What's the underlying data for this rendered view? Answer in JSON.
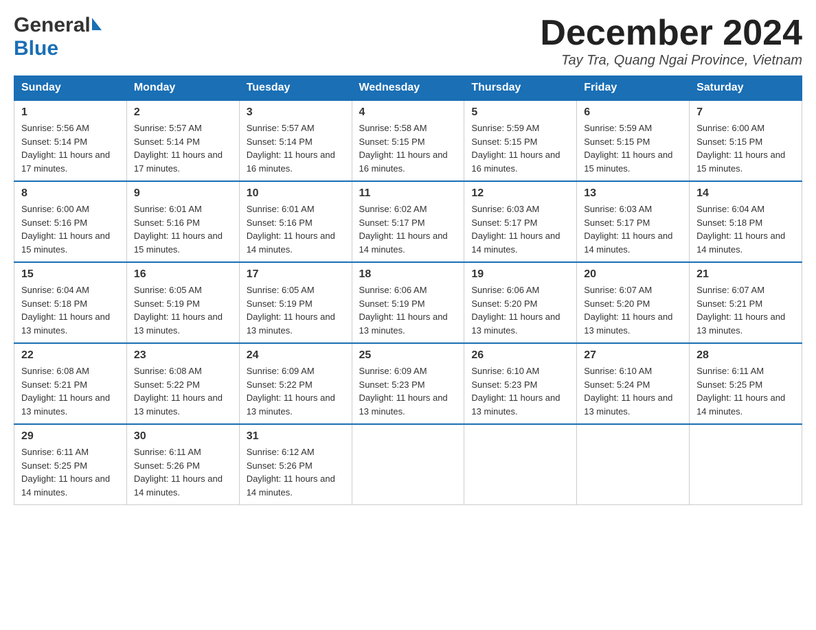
{
  "header": {
    "logo": {
      "general": "General",
      "blue": "Blue"
    },
    "title": "December 2024",
    "location": "Tay Tra, Quang Ngai Province, Vietnam"
  },
  "calendar": {
    "days": [
      "Sunday",
      "Monday",
      "Tuesday",
      "Wednesday",
      "Thursday",
      "Friday",
      "Saturday"
    ],
    "weeks": [
      [
        {
          "day": "1",
          "sunrise": "5:56 AM",
          "sunset": "5:14 PM",
          "daylight": "11 hours and 17 minutes."
        },
        {
          "day": "2",
          "sunrise": "5:57 AM",
          "sunset": "5:14 PM",
          "daylight": "11 hours and 17 minutes."
        },
        {
          "day": "3",
          "sunrise": "5:57 AM",
          "sunset": "5:14 PM",
          "daylight": "11 hours and 16 minutes."
        },
        {
          "day": "4",
          "sunrise": "5:58 AM",
          "sunset": "5:15 PM",
          "daylight": "11 hours and 16 minutes."
        },
        {
          "day": "5",
          "sunrise": "5:59 AM",
          "sunset": "5:15 PM",
          "daylight": "11 hours and 16 minutes."
        },
        {
          "day": "6",
          "sunrise": "5:59 AM",
          "sunset": "5:15 PM",
          "daylight": "11 hours and 15 minutes."
        },
        {
          "day": "7",
          "sunrise": "6:00 AM",
          "sunset": "5:15 PM",
          "daylight": "11 hours and 15 minutes."
        }
      ],
      [
        {
          "day": "8",
          "sunrise": "6:00 AM",
          "sunset": "5:16 PM",
          "daylight": "11 hours and 15 minutes."
        },
        {
          "day": "9",
          "sunrise": "6:01 AM",
          "sunset": "5:16 PM",
          "daylight": "11 hours and 15 minutes."
        },
        {
          "day": "10",
          "sunrise": "6:01 AM",
          "sunset": "5:16 PM",
          "daylight": "11 hours and 14 minutes."
        },
        {
          "day": "11",
          "sunrise": "6:02 AM",
          "sunset": "5:17 PM",
          "daylight": "11 hours and 14 minutes."
        },
        {
          "day": "12",
          "sunrise": "6:03 AM",
          "sunset": "5:17 PM",
          "daylight": "11 hours and 14 minutes."
        },
        {
          "day": "13",
          "sunrise": "6:03 AM",
          "sunset": "5:17 PM",
          "daylight": "11 hours and 14 minutes."
        },
        {
          "day": "14",
          "sunrise": "6:04 AM",
          "sunset": "5:18 PM",
          "daylight": "11 hours and 14 minutes."
        }
      ],
      [
        {
          "day": "15",
          "sunrise": "6:04 AM",
          "sunset": "5:18 PM",
          "daylight": "11 hours and 13 minutes."
        },
        {
          "day": "16",
          "sunrise": "6:05 AM",
          "sunset": "5:19 PM",
          "daylight": "11 hours and 13 minutes."
        },
        {
          "day": "17",
          "sunrise": "6:05 AM",
          "sunset": "5:19 PM",
          "daylight": "11 hours and 13 minutes."
        },
        {
          "day": "18",
          "sunrise": "6:06 AM",
          "sunset": "5:19 PM",
          "daylight": "11 hours and 13 minutes."
        },
        {
          "day": "19",
          "sunrise": "6:06 AM",
          "sunset": "5:20 PM",
          "daylight": "11 hours and 13 minutes."
        },
        {
          "day": "20",
          "sunrise": "6:07 AM",
          "sunset": "5:20 PM",
          "daylight": "11 hours and 13 minutes."
        },
        {
          "day": "21",
          "sunrise": "6:07 AM",
          "sunset": "5:21 PM",
          "daylight": "11 hours and 13 minutes."
        }
      ],
      [
        {
          "day": "22",
          "sunrise": "6:08 AM",
          "sunset": "5:21 PM",
          "daylight": "11 hours and 13 minutes."
        },
        {
          "day": "23",
          "sunrise": "6:08 AM",
          "sunset": "5:22 PM",
          "daylight": "11 hours and 13 minutes."
        },
        {
          "day": "24",
          "sunrise": "6:09 AM",
          "sunset": "5:22 PM",
          "daylight": "11 hours and 13 minutes."
        },
        {
          "day": "25",
          "sunrise": "6:09 AM",
          "sunset": "5:23 PM",
          "daylight": "11 hours and 13 minutes."
        },
        {
          "day": "26",
          "sunrise": "6:10 AM",
          "sunset": "5:23 PM",
          "daylight": "11 hours and 13 minutes."
        },
        {
          "day": "27",
          "sunrise": "6:10 AM",
          "sunset": "5:24 PM",
          "daylight": "11 hours and 13 minutes."
        },
        {
          "day": "28",
          "sunrise": "6:11 AM",
          "sunset": "5:25 PM",
          "daylight": "11 hours and 14 minutes."
        }
      ],
      [
        {
          "day": "29",
          "sunrise": "6:11 AM",
          "sunset": "5:25 PM",
          "daylight": "11 hours and 14 minutes."
        },
        {
          "day": "30",
          "sunrise": "6:11 AM",
          "sunset": "5:26 PM",
          "daylight": "11 hours and 14 minutes."
        },
        {
          "day": "31",
          "sunrise": "6:12 AM",
          "sunset": "5:26 PM",
          "daylight": "11 hours and 14 minutes."
        },
        null,
        null,
        null,
        null
      ]
    ]
  }
}
